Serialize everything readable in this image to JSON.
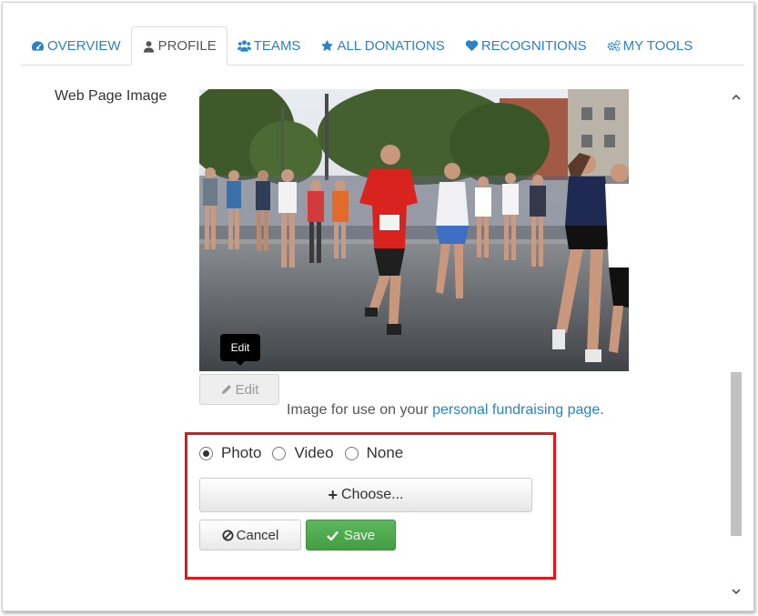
{
  "tabs": [
    {
      "label": "OVERVIEW",
      "icon": "dashboard-icon",
      "active": false
    },
    {
      "label": "PROFILE",
      "icon": "user-icon",
      "active": true
    },
    {
      "label": "TEAMS",
      "icon": "users-icon",
      "active": false
    },
    {
      "label": "ALL DONATIONS",
      "icon": "star-icon",
      "active": false
    },
    {
      "label": "RECOGNITIONS",
      "icon": "heart-icon",
      "active": false
    },
    {
      "label": "MY TOOLS",
      "icon": "cogs-icon",
      "active": false
    }
  ],
  "field": {
    "label": "Web Page Image",
    "tooltip": "Edit",
    "edit_button": "Edit",
    "help_text": "Image for use on your ",
    "help_link": "personal fundraising page",
    "help_suffix": "."
  },
  "media_options": {
    "selected": "Photo",
    "options": [
      "Photo",
      "Video",
      "None"
    ]
  },
  "actions": {
    "choose_label": "Choose...",
    "cancel_label": "Cancel",
    "save_label": "Save"
  },
  "colors": {
    "link": "#2a83c6",
    "save_green": "#5cb85c",
    "highlight_red": "#e0161a"
  }
}
